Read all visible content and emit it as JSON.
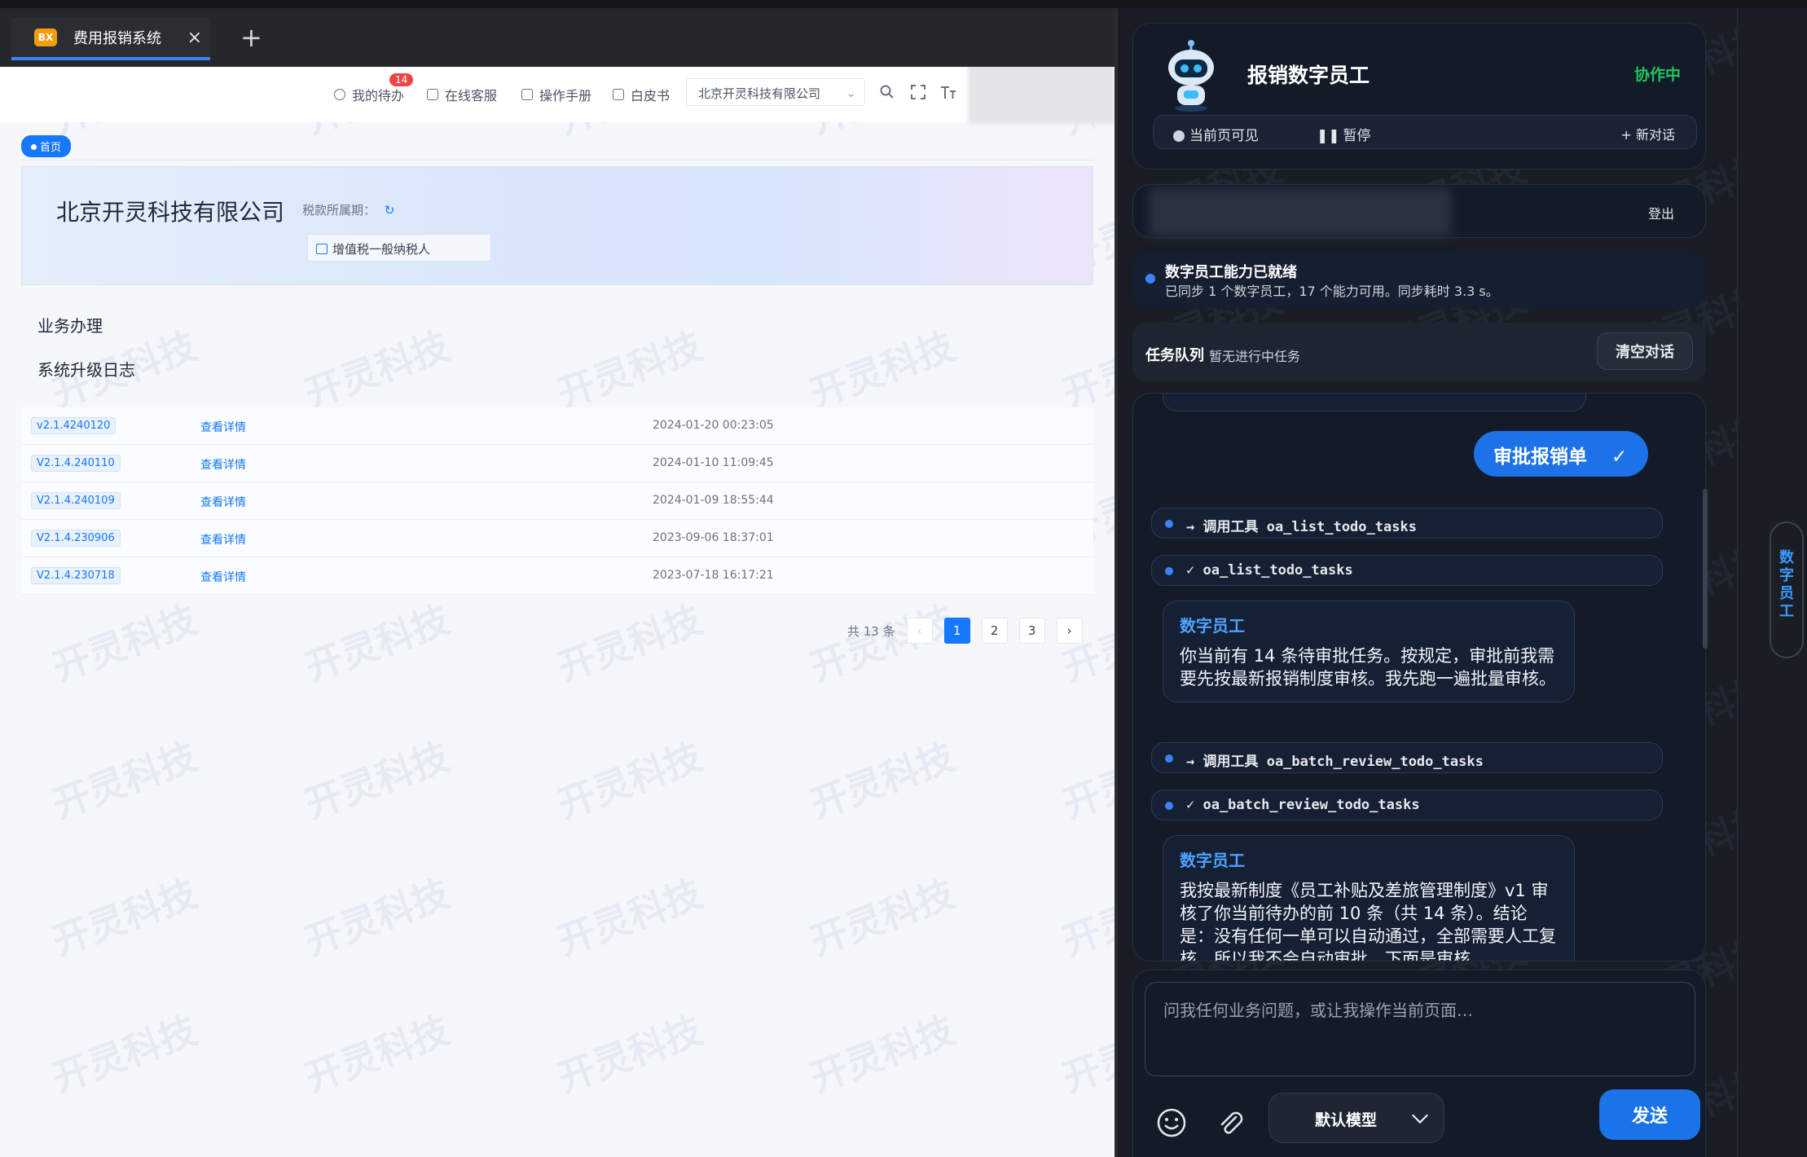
{
  "browser": {
    "tab_logo": "BX",
    "tab_title": "费用报销系统",
    "tab_close": "×",
    "tab_add": "+"
  },
  "toolbar": {
    "todo_label": "我的待办",
    "todo_badge": "14",
    "service_label": "在线客服",
    "manual_label": "操作手册",
    "whitepaper_label": "白皮书",
    "company_select": "北京开灵科技有限公司"
  },
  "breadcrumb": {
    "home": "首页"
  },
  "banner": {
    "company": "北京开灵科技有限公司",
    "tax_period_label": "税款所属期：",
    "taxpayer_type": "增值税一般纳税人"
  },
  "sections": {
    "business": "业务办理",
    "upgrade_log": "系统升级日志"
  },
  "upgrade_rows": [
    {
      "version": "v2.1.4240120",
      "action": "查看详情",
      "time": "2024-01-20 00:23:05"
    },
    {
      "version": "V2.1.4.240110",
      "action": "查看详情",
      "time": "2024-01-10 11:09:45"
    },
    {
      "version": "V2.1.4.240109",
      "action": "查看详情",
      "time": "2024-01-09 18:55:44"
    },
    {
      "version": "V2.1.4.230906",
      "action": "查看详情",
      "time": "2023-09-06 18:37:01"
    },
    {
      "version": "V2.1.4.230718",
      "action": "查看详情",
      "time": "2023-07-18 16:17:21"
    }
  ],
  "pagination": {
    "total": "共 13 条",
    "prev": "‹",
    "pages": [
      "1",
      "2",
      "3"
    ],
    "current": "1",
    "next": "›"
  },
  "watermark": "开灵科技",
  "assistant": {
    "title": "报销数字员工",
    "status": "协作中",
    "visible_label": "当前页可见",
    "pause_label": "暂停",
    "new_chat_label": "+ 新对话",
    "logout_label": "登出",
    "ready_title": "数字员工能力已就绪",
    "ready_sub": "已同步 1 个数字员工，17 个能力可用。同步耗时 3.3 s。",
    "queue_title": "任务队列",
    "queue_status": "暂无进行中任务",
    "clear_label": "清空对话",
    "user_message": "审批报销单",
    "user_check": "✓",
    "tool_call_1": "→ 调用工具 oa_list_todo_tasks",
    "tool_done_1": "✓ oa_list_todo_tasks",
    "ai_name": "数字员工",
    "ai_text_1": "你当前有 14 条待审批任务。按规定，审批前我需要先按最新报销制度审核。我先跑一遍批量审核。",
    "tool_call_2": "→ 调用工具 oa_batch_review_todo_tasks",
    "tool_done_2": "✓ oa_batch_review_todo_tasks",
    "ai_text_2": "我按最新制度《员工补贴及差旅管理制度》v1 审核了你当前待办的前 10 条（共 14 条）。结论是：没有任何一单可以自动通过，全部需要人工复核。所以我不会自动审批，下面是审核",
    "input_placeholder": "问我任何业务问题，或让我操作当前页面…",
    "model_label": "默认模型",
    "send_label": "发送",
    "side_tab_label": "数字员工"
  },
  "colors": {
    "accent": "#1677ff",
    "status_green": "#22c55e",
    "panel_bg": "#131a28",
    "badge_red": "#ef4444"
  }
}
